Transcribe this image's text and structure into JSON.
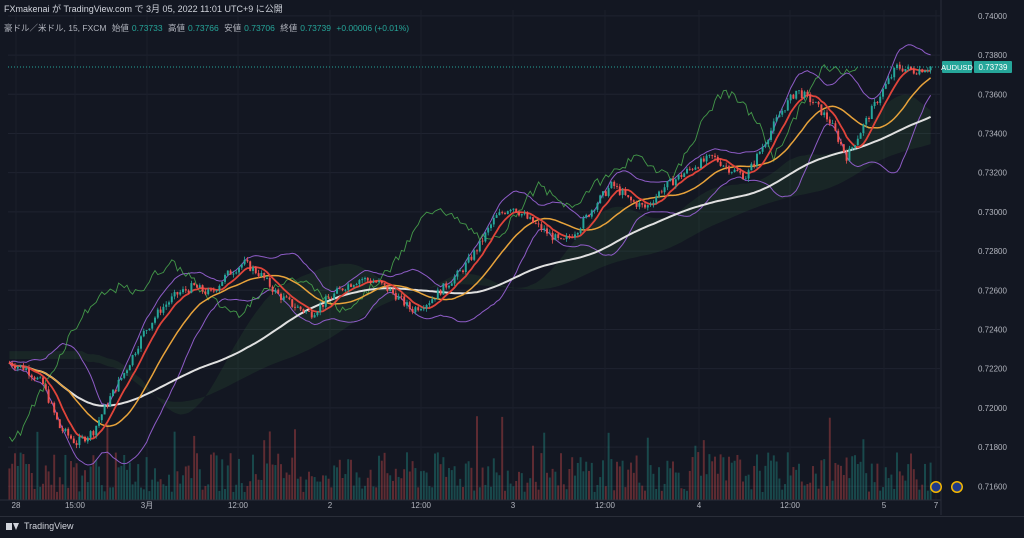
{
  "header": {
    "publish_text": "FXmakenai が TradingView.com で 3月 05, 2022 11:01 UTC+9 に公開"
  },
  "legend": {
    "symbol": "豪ドル／米ドル, 15, FXCM",
    "open_label": "始値",
    "open": "0.73733",
    "high_label": "高値",
    "high": "0.73766",
    "low_label": "安値",
    "low": "0.73706",
    "close_label": "終値",
    "close": "0.73739",
    "change": "+0.00006 (+0.01%)"
  },
  "badge": {
    "ticker": "AUDUSD",
    "price": "0.73739"
  },
  "footer": {
    "brand": "TradingView"
  },
  "colors": {
    "up": "#26a69a",
    "down": "#ef5350",
    "bg": "#131722",
    "ma_fast": "#e0443a",
    "ma_mid": "#e8a33b",
    "ma_slow": "#e0e0e0",
    "bollinger": "#8e5cc7",
    "lagging_span": "#4caf50"
  },
  "chart_data": {
    "type": "line",
    "title": "",
    "y_ticks": [
      "0.74000",
      "0.73800",
      "0.73600",
      "0.73400",
      "0.73200",
      "0.73000",
      "0.72800",
      "0.72600",
      "0.72400",
      "0.72200",
      "0.72000",
      "0.71800",
      "0.71600"
    ],
    "x_ticks": [
      "28",
      "15:00",
      "3月",
      "12:00",
      "2",
      "12:00",
      "3",
      "12:00",
      "4",
      "12:00",
      "5",
      "7"
    ],
    "ylim": [
      0.7153,
      0.7403
    ],
    "price_series_approx": [
      [
        0,
        0.7223
      ],
      [
        2,
        0.722
      ],
      [
        4,
        0.7212
      ],
      [
        6,
        0.719
      ],
      [
        8,
        0.7182
      ],
      [
        10,
        0.7188
      ],
      [
        12,
        0.7205
      ],
      [
        14,
        0.722
      ],
      [
        16,
        0.7238
      ],
      [
        18,
        0.725
      ],
      [
        20,
        0.7258
      ],
      [
        22,
        0.7262
      ],
      [
        24,
        0.7258
      ],
      [
        26,
        0.7268
      ],
      [
        28,
        0.7274
      ],
      [
        30,
        0.7268
      ],
      [
        32,
        0.7258
      ],
      [
        34,
        0.7252
      ],
      [
        36,
        0.7248
      ],
      [
        38,
        0.7255
      ],
      [
        40,
        0.7262
      ],
      [
        42,
        0.7266
      ],
      [
        44,
        0.7264
      ],
      [
        46,
        0.7258
      ],
      [
        48,
        0.725
      ],
      [
        50,
        0.7254
      ],
      [
        52,
        0.7262
      ],
      [
        54,
        0.727
      ],
      [
        56,
        0.7282
      ],
      [
        58,
        0.7297
      ],
      [
        60,
        0.7303
      ],
      [
        62,
        0.7296
      ],
      [
        64,
        0.729
      ],
      [
        66,
        0.7284
      ],
      [
        68,
        0.7292
      ],
      [
        70,
        0.7304
      ],
      [
        72,
        0.7314
      ],
      [
        74,
        0.7306
      ],
      [
        76,
        0.7302
      ],
      [
        78,
        0.7312
      ],
      [
        80,
        0.7318
      ],
      [
        82,
        0.7324
      ],
      [
        84,
        0.7328
      ],
      [
        86,
        0.7322
      ],
      [
        88,
        0.7318
      ],
      [
        90,
        0.7334
      ],
      [
        92,
        0.735
      ],
      [
        94,
        0.7362
      ],
      [
        96,
        0.7356
      ],
      [
        98,
        0.7346
      ],
      [
        100,
        0.7328
      ],
      [
        102,
        0.7344
      ],
      [
        104,
        0.736
      ],
      [
        106,
        0.7374
      ],
      [
        108,
        0.7372
      ],
      [
        110,
        0.7374
      ]
    ],
    "last_price": 0.73739,
    "series": [
      {
        "name": "",
        "style": "candles"
      },
      {
        "name": "",
        "style": "line",
        "color": "#e0443a"
      },
      {
        "name": "",
        "style": "line",
        "color": "#e8a33b"
      },
      {
        "name": "",
        "style": "line",
        "color": "#e0e0e0"
      }
    ],
    "volume_panel": true,
    "grid": true
  }
}
